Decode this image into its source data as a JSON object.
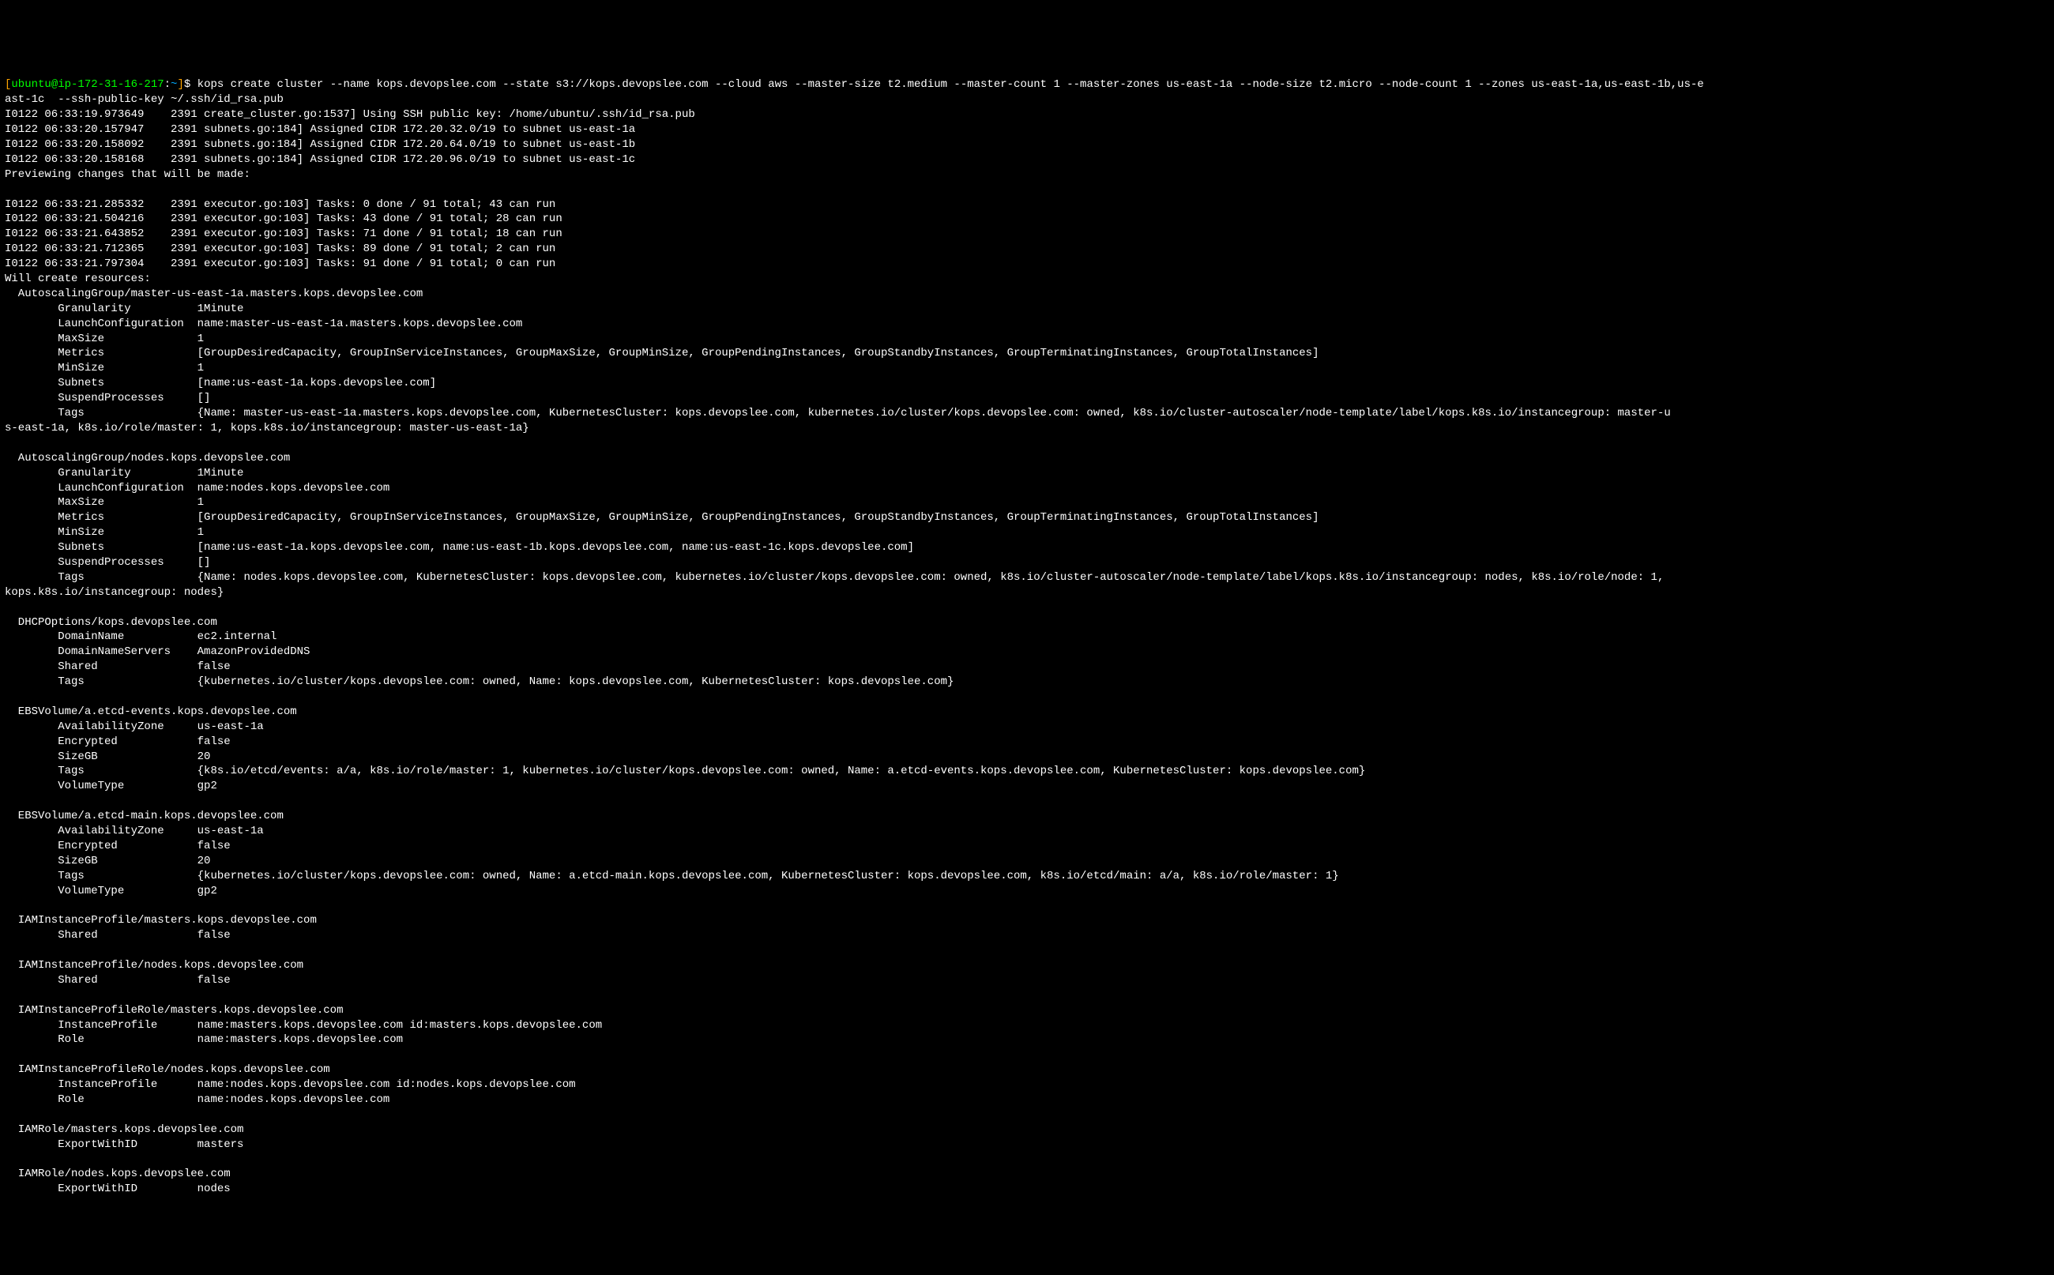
{
  "prompt": {
    "open_bracket": "[",
    "user_host": "ubuntu@ip-172-31-16-217",
    "colon": ":",
    "tilde": "~",
    "dollar": "$ ",
    "command": "kops create cluster --name kops.devopslee.com --state s3://kops.devopslee.com --cloud aws --master-size t2.medium --master-count 1 --master-zones us-east-1a --node-size t2.micro --node-count 1 --zones us-east-1a,us-east-1b,us-e",
    "close_bracket": "]"
  },
  "cmd_cont": "ast-1c  --ssh-public-key ~/.ssh/id_rsa.pub",
  "log_lines": [
    "I0122 06:33:19.973649    2391 create_cluster.go:1537] Using SSH public key: /home/ubuntu/.ssh/id_rsa.pub",
    "I0122 06:33:20.157947    2391 subnets.go:184] Assigned CIDR 172.20.32.0/19 to subnet us-east-1a",
    "I0122 06:33:20.158092    2391 subnets.go:184] Assigned CIDR 172.20.64.0/19 to subnet us-east-1b",
    "I0122 06:33:20.158168    2391 subnets.go:184] Assigned CIDR 172.20.96.0/19 to subnet us-east-1c",
    "Previewing changes that will be made:",
    "",
    "I0122 06:33:21.285332    2391 executor.go:103] Tasks: 0 done / 91 total; 43 can run",
    "I0122 06:33:21.504216    2391 executor.go:103] Tasks: 43 done / 91 total; 28 can run",
    "I0122 06:33:21.643852    2391 executor.go:103] Tasks: 71 done / 91 total; 18 can run",
    "I0122 06:33:21.712365    2391 executor.go:103] Tasks: 89 done / 91 total; 2 can run",
    "I0122 06:33:21.797304    2391 executor.go:103] Tasks: 91 done / 91 total; 0 can run",
    "Will create resources:",
    "  AutoscalingGroup/master-us-east-1a.masters.kops.devopslee.com",
    "        Granularity          1Minute",
    "        LaunchConfiguration  name:master-us-east-1a.masters.kops.devopslee.com",
    "        MaxSize              1",
    "        Metrics              [GroupDesiredCapacity, GroupInServiceInstances, GroupMaxSize, GroupMinSize, GroupPendingInstances, GroupStandbyInstances, GroupTerminatingInstances, GroupTotalInstances]",
    "        MinSize              1",
    "        Subnets              [name:us-east-1a.kops.devopslee.com]",
    "        SuspendProcesses     []",
    "        Tags                 {Name: master-us-east-1a.masters.kops.devopslee.com, KubernetesCluster: kops.devopslee.com, kubernetes.io/cluster/kops.devopslee.com: owned, k8s.io/cluster-autoscaler/node-template/label/kops.k8s.io/instancegroup: master-u",
    "s-east-1a, k8s.io/role/master: 1, kops.k8s.io/instancegroup: master-us-east-1a}",
    "",
    "  AutoscalingGroup/nodes.kops.devopslee.com",
    "        Granularity          1Minute",
    "        LaunchConfiguration  name:nodes.kops.devopslee.com",
    "        MaxSize              1",
    "        Metrics              [GroupDesiredCapacity, GroupInServiceInstances, GroupMaxSize, GroupMinSize, GroupPendingInstances, GroupStandbyInstances, GroupTerminatingInstances, GroupTotalInstances]",
    "        MinSize              1",
    "        Subnets              [name:us-east-1a.kops.devopslee.com, name:us-east-1b.kops.devopslee.com, name:us-east-1c.kops.devopslee.com]",
    "        SuspendProcesses     []",
    "        Tags                 {Name: nodes.kops.devopslee.com, KubernetesCluster: kops.devopslee.com, kubernetes.io/cluster/kops.devopslee.com: owned, k8s.io/cluster-autoscaler/node-template/label/kops.k8s.io/instancegroup: nodes, k8s.io/role/node: 1, ",
    "kops.k8s.io/instancegroup: nodes}",
    "",
    "  DHCPOptions/kops.devopslee.com",
    "        DomainName           ec2.internal",
    "        DomainNameServers    AmazonProvidedDNS",
    "        Shared               false",
    "        Tags                 {kubernetes.io/cluster/kops.devopslee.com: owned, Name: kops.devopslee.com, KubernetesCluster: kops.devopslee.com}",
    "",
    "  EBSVolume/a.etcd-events.kops.devopslee.com",
    "        AvailabilityZone     us-east-1a",
    "        Encrypted            false",
    "        SizeGB               20",
    "        Tags                 {k8s.io/etcd/events: a/a, k8s.io/role/master: 1, kubernetes.io/cluster/kops.devopslee.com: owned, Name: a.etcd-events.kops.devopslee.com, KubernetesCluster: kops.devopslee.com}",
    "        VolumeType           gp2",
    "",
    "  EBSVolume/a.etcd-main.kops.devopslee.com",
    "        AvailabilityZone     us-east-1a",
    "        Encrypted            false",
    "        SizeGB               20",
    "        Tags                 {kubernetes.io/cluster/kops.devopslee.com: owned, Name: a.etcd-main.kops.devopslee.com, KubernetesCluster: kops.devopslee.com, k8s.io/etcd/main: a/a, k8s.io/role/master: 1}",
    "        VolumeType           gp2",
    "",
    "  IAMInstanceProfile/masters.kops.devopslee.com",
    "        Shared               false",
    "",
    "  IAMInstanceProfile/nodes.kops.devopslee.com",
    "        Shared               false",
    "",
    "  IAMInstanceProfileRole/masters.kops.devopslee.com",
    "        InstanceProfile      name:masters.kops.devopslee.com id:masters.kops.devopslee.com",
    "        Role                 name:masters.kops.devopslee.com",
    "",
    "  IAMInstanceProfileRole/nodes.kops.devopslee.com",
    "        InstanceProfile      name:nodes.kops.devopslee.com id:nodes.kops.devopslee.com",
    "        Role                 name:nodes.kops.devopslee.com",
    "",
    "  IAMRole/masters.kops.devopslee.com",
    "        ExportWithID         masters",
    "",
    "  IAMRole/nodes.kops.devopslee.com",
    "        ExportWithID         nodes"
  ]
}
